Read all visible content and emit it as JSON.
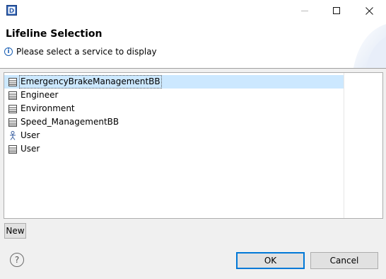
{
  "titlebar": {
    "app_icon": "d-app-icon",
    "minimize_icon": "minimize-icon",
    "maximize_icon": "maximize-icon",
    "close_icon": "close-icon"
  },
  "header": {
    "title": "Lifeline Selection",
    "message": "Please select a service to display",
    "message_icon": "info-icon"
  },
  "list": {
    "items": [
      {
        "label": "EmergencyBrakeManagementBB",
        "icon": "component-icon",
        "selected": true
      },
      {
        "label": "Engineer",
        "icon": "component-icon",
        "selected": false
      },
      {
        "label": "Environment",
        "icon": "component-icon",
        "selected": false
      },
      {
        "label": "Speed_ManagementBB",
        "icon": "component-icon",
        "selected": false
      },
      {
        "label": "User",
        "icon": "actor-icon",
        "selected": false
      },
      {
        "label": "User",
        "icon": "component-icon",
        "selected": false
      }
    ]
  },
  "buttons": {
    "new_label": "New",
    "ok_label": "OK",
    "cancel_label": "Cancel",
    "help_icon": "help-icon"
  },
  "colors": {
    "selection": "#cce8ff",
    "default_button_border": "#0078d7",
    "info_blue": "#1a5fb4"
  }
}
